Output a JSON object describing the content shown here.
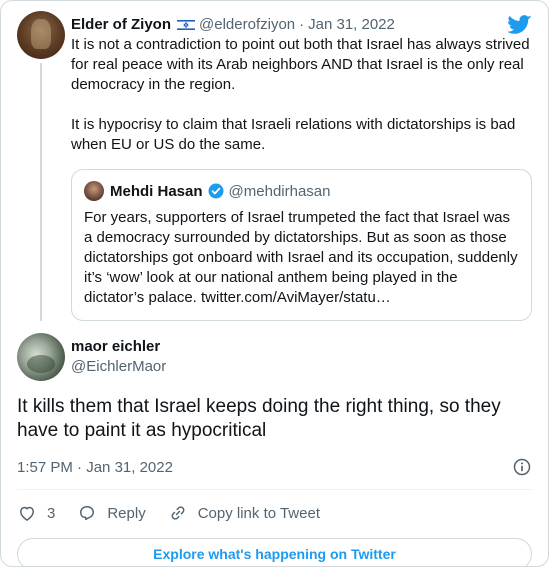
{
  "parent_tweet": {
    "display_name": "Elder of Ziyon",
    "handle": "@elderofziyon",
    "date": "Jan 31, 2022",
    "separator": "·",
    "paragraphs": [
      "It is not a contradiction to point out both that Israel has always strived for real peace with its Arab neighbors AND that Israel is the only real democracy in the region.",
      "It is hypocrisy to claim that Israeli relations with dictatorships is bad when EU or US do the same."
    ],
    "quoted": {
      "display_name": "Mehdi Hasan",
      "handle": "@mehdirhasan",
      "text": "For years, supporters of Israel trumpeted the fact that Israel was a democracy surrounded by dictatorships. But as soon as those dictatorships got onboard with Israel and its occupation, suddenly it’s ‘wow’ look at our national anthem being played in the dictator’s palace. twitter.com/AviMayer/statu…"
    }
  },
  "main_tweet": {
    "display_name": "maor eichler",
    "handle": "@EichlerMaor",
    "text": "It kills them that Israel keeps doing the right thing, so they have to paint it as hypocritical",
    "time": "1:57 PM",
    "separator": "·",
    "date": "Jan 31, 2022"
  },
  "actions": {
    "like_count": "3",
    "reply_label": "Reply",
    "copy_link_label": "Copy link to Tweet"
  },
  "cta_label": "Explore what's happening on Twitter",
  "colors": {
    "accent": "#1d9bf0",
    "muted": "#536471",
    "text": "#0f1419",
    "border": "#cfd9de"
  },
  "icons": [
    "twitter-bird-icon",
    "israel-flag-icon",
    "verified-badge-icon",
    "info-icon",
    "heart-icon",
    "reply-icon",
    "link-icon"
  ]
}
